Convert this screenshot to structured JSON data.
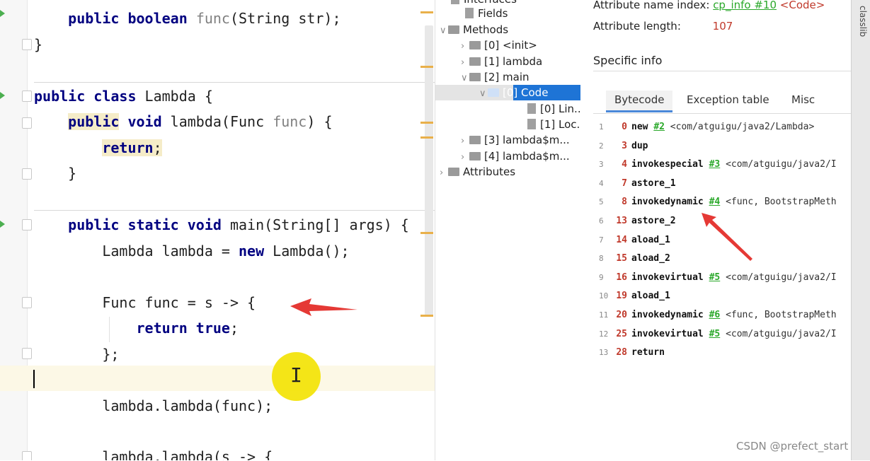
{
  "editor": {
    "lines": [
      {
        "id": "l1",
        "parts": [
          {
            "t": "    "
          },
          {
            "t": "public",
            "c": "kw hl2"
          },
          {
            "t": " "
          },
          {
            "t": "boolean",
            "c": "kw"
          },
          {
            "t": " "
          },
          {
            "t": "func",
            "c": "param"
          },
          {
            "t": "(String str);"
          }
        ]
      },
      {
        "id": "l2",
        "parts": [
          {
            "t": "}"
          }
        ]
      },
      {
        "id": "l3",
        "parts": [
          {
            "t": "public",
            "c": "kw"
          },
          {
            "t": " "
          },
          {
            "t": "class",
            "c": "kw"
          },
          {
            "t": " Lambda {"
          }
        ]
      },
      {
        "id": "l4",
        "parts": [
          {
            "t": "    "
          },
          {
            "t": "public",
            "c": "kw hl"
          },
          {
            "t": " "
          },
          {
            "t": "void",
            "c": "kw"
          },
          {
            "t": " lambda(Func "
          },
          {
            "t": "func",
            "c": "param"
          },
          {
            "t": ") {"
          }
        ]
      },
      {
        "id": "l5",
        "parts": [
          {
            "t": "        "
          },
          {
            "t": "return",
            "c": "kw hl"
          },
          {
            "t": ";",
            "c": "hl"
          }
        ]
      },
      {
        "id": "l6",
        "parts": [
          {
            "t": "    }"
          }
        ]
      },
      {
        "id": "l7",
        "parts": [
          {
            "t": "    "
          },
          {
            "t": "public",
            "c": "kw"
          },
          {
            "t": " "
          },
          {
            "t": "static",
            "c": "kw"
          },
          {
            "t": " "
          },
          {
            "t": "void",
            "c": "kw"
          },
          {
            "t": " main(String[] args) {"
          }
        ]
      },
      {
        "id": "l8",
        "parts": [
          {
            "t": "        Lambda lambda = "
          },
          {
            "t": "new",
            "c": "kw"
          },
          {
            "t": " Lambda();"
          }
        ]
      },
      {
        "id": "l9",
        "parts": [
          {
            "t": "        Func func = s -> {"
          }
        ]
      },
      {
        "id": "l10",
        "parts": [
          {
            "t": "            "
          },
          {
            "t": "return",
            "c": "kw"
          },
          {
            "t": " "
          },
          {
            "t": "true",
            "c": "kw"
          },
          {
            "t": ";"
          }
        ]
      },
      {
        "id": "l11",
        "parts": [
          {
            "t": "        };"
          }
        ]
      },
      {
        "id": "l12",
        "parts": [
          {
            "t": "        lambda.lambda(func);"
          }
        ]
      },
      {
        "id": "l13",
        "parts": [
          {
            "t": "        lambda.lambda(s -> {"
          }
        ]
      }
    ]
  },
  "tree": {
    "items": [
      {
        "label": "Interfaces",
        "icon": "file",
        "expand": ""
      },
      {
        "label": "Fields",
        "icon": "file",
        "expand": ""
      },
      {
        "label": "Methods",
        "icon": "folder",
        "expand": "v"
      },
      {
        "label": "[0] <init>",
        "icon": "folder",
        "expand": ">"
      },
      {
        "label": "[1] lambda",
        "icon": "folder",
        "expand": ">"
      },
      {
        "label": "[2] main",
        "icon": "folder",
        "expand": "v"
      },
      {
        "label": "[0] Code",
        "icon": "folder",
        "expand": "v"
      },
      {
        "label": "[0] Lin...",
        "icon": "file",
        "expand": ""
      },
      {
        "label": "[1] Loc...",
        "icon": "file",
        "expand": ""
      },
      {
        "label": "[3] lambda$m...",
        "icon": "folder",
        "expand": ">"
      },
      {
        "label": "[4] lambda$m...",
        "icon": "folder",
        "expand": ">"
      },
      {
        "label": "Attributes",
        "icon": "folder",
        "expand": ">"
      }
    ]
  },
  "info": {
    "attr_name_index_label": "Attribute name index:",
    "attr_name_index_link": "cp_info #10",
    "attr_name_index_value": "<Code>",
    "attr_length_label": "Attribute length:",
    "attr_length_value": "107",
    "specific_info": "Specific info",
    "tabs": [
      "Bytecode",
      "Exception table",
      "Misc"
    ],
    "bytecode": [
      {
        "ln": "1",
        "off": "0",
        "ins": "new",
        "ref": "#2",
        "cmt": "<com/atguigu/java2/Lambda>"
      },
      {
        "ln": "2",
        "off": "3",
        "ins": "dup",
        "ref": "",
        "cmt": ""
      },
      {
        "ln": "3",
        "off": "4",
        "ins": "invokespecial",
        "ref": "#3",
        "cmt": "<com/atguigu/java2/I"
      },
      {
        "ln": "4",
        "off": "7",
        "ins": "astore_1",
        "ref": "",
        "cmt": ""
      },
      {
        "ln": "5",
        "off": "8",
        "ins": "invokedynamic",
        "ref": "#4",
        "cmt": "<func, BootstrapMeth"
      },
      {
        "ln": "6",
        "off": "13",
        "ins": "astore_2",
        "ref": "",
        "cmt": ""
      },
      {
        "ln": "7",
        "off": "14",
        "ins": "aload_1",
        "ref": "",
        "cmt": ""
      },
      {
        "ln": "8",
        "off": "15",
        "ins": "aload_2",
        "ref": "",
        "cmt": ""
      },
      {
        "ln": "9",
        "off": "16",
        "ins": "invokevirtual",
        "ref": "#5",
        "cmt": "<com/atguigu/java2/I"
      },
      {
        "ln": "10",
        "off": "19",
        "ins": "aload_1",
        "ref": "",
        "cmt": ""
      },
      {
        "ln": "11",
        "off": "20",
        "ins": "invokedynamic",
        "ref": "#6",
        "cmt": "<func, BootstrapMeth"
      },
      {
        "ln": "12",
        "off": "25",
        "ins": "invokevirtual",
        "ref": "#5",
        "cmt": "<com/atguigu/java2/I"
      },
      {
        "ln": "13",
        "off": "28",
        "ins": "return",
        "ref": "",
        "cmt": ""
      }
    ]
  },
  "side_tab": "classlib",
  "watermark": "CSDN @prefect_start"
}
